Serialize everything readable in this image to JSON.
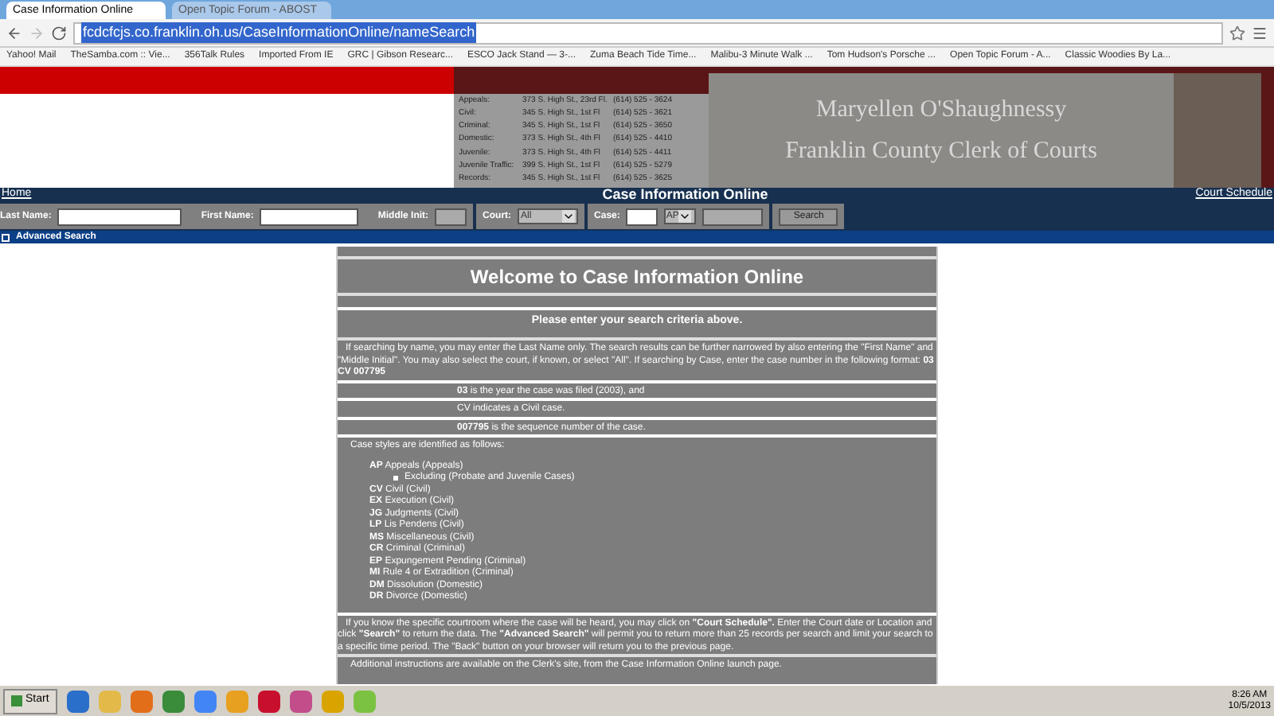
{
  "browser": {
    "tabs": [
      {
        "title": "Case Information Online",
        "selected": true
      },
      {
        "title": "Open Topic Forum - ABOST",
        "selected": false
      }
    ],
    "url": "fcdcfcjs.co.franklin.oh.us/CaseInformationOnline/nameSearch",
    "bookmarks": [
      "Yahoo! Mail",
      "TheSamba.com :: Vie...",
      "356Talk Rules",
      "Imported From IE",
      "GRC | Gibson Researc...",
      "ESCO Jack Stand — 3-...",
      "Zuma Beach Tide Time...",
      "Malibu-3 Minute Walk ...",
      "Tom Hudson's Porsche ...",
      "Open Topic Forum - A...",
      "Classic Woodies By La..."
    ]
  },
  "header": {
    "offices": [
      {
        "court": "Appeals:",
        "address": "373 S. High St., 23rd Fl.",
        "phone": "(614) 525 - 3624"
      },
      {
        "court": "Civil:",
        "address": "345 S. High St., 1st Fl",
        "phone": "(614) 525 - 3621"
      },
      {
        "court": "Criminal:",
        "address": "345 S. High St., 1st Fl",
        "phone": "(614) 525 - 3650"
      },
      {
        "court": "Domestic:",
        "address": "373 S. High St., 4th Fl",
        "phone": "(614) 525 - 4410"
      },
      {
        "court": "Juvenile:",
        "address": "373 S. High St., 4th Fl",
        "phone": "(614) 525 - 4411"
      },
      {
        "court": "Juvenile Traffic:",
        "address": "399 S. High St., 1st Fl",
        "phone": "(614) 525 - 5279"
      },
      {
        "court": "Records:",
        "address": "345 S. High St., 1st Fl",
        "phone": "(614) 525 - 3625"
      }
    ],
    "name": "Maryellen O'Shaughnessy",
    "office": "Franklin County Clerk of Courts"
  },
  "nav": {
    "home": "Home",
    "title": "Case Information Online",
    "schedule": "Court Schedule"
  },
  "search": {
    "last_name": "Last Name:",
    "first_name": "First Name:",
    "middle_init": "Middle Init:",
    "court": "Court:",
    "court_value": "All",
    "case": "Case:",
    "case_type": "AP",
    "button": "Search",
    "advanced": "Advanced Search"
  },
  "content": {
    "welcome": "Welcome to Case Information Online",
    "prompt": "Please enter your search criteria above.",
    "intro": "If searching by name, you may enter the Last Name only. The search results can be further narrowed by also entering the \"First Name\" and \"Middle Initial\". You may also select the court, if known, or select \"All\". If searching by Case, enter the case number in the following format: **03 CV 007795**",
    "format_lines": [
      "**03** is the year the case was filed (2003), and",
      "CV indicates a Civil case.",
      "**007795** is the sequence number of the case."
    ],
    "styles_intro": "Case styles are identified as follows:",
    "styles": [
      {
        "code": "AP",
        "label": "Appeals (Appeals)",
        "children": [
          "Excluding (Probate and Juvenile Cases)"
        ]
      },
      {
        "code": "CV",
        "label": "Civil (Civil)"
      },
      {
        "code": "EX",
        "label": "Execution (Civil)"
      },
      {
        "code": "JG",
        "label": "Judgments (Civil)"
      },
      {
        "code": "LP",
        "label": "Lis Pendens (Civil)"
      },
      {
        "code": "MS",
        "label": "Miscellaneous (Civil)"
      },
      {
        "code": "CR",
        "label": "Criminal (Criminal)"
      },
      {
        "code": "EP",
        "label": "Expungement Pending (Criminal)"
      },
      {
        "code": "MI",
        "label": "Rule 4 or Extradition (Criminal)"
      },
      {
        "code": "DM",
        "label": "Dissolution (Domestic)"
      },
      {
        "code": "DR",
        "label": "Divorce (Domestic)"
      }
    ],
    "schedule_note": "If you know the specific courtroom where the case will be heard, you may click on **\"Court Schedule\".** Enter the Court date or Location and click **\"Search\"** to return the data. The **\"Advanced Search\"** will permit you to return more than 25 records per search and limit your search to a specific time period. The \"Back\" button on your browser will return you to the previous page.",
    "additional": "Additional instructions are available on the Clerk's site, from the Case Information Online launch page."
  },
  "taskbar": {
    "start": "Start",
    "time": "8:26 AM",
    "date": "10/5/2013"
  }
}
